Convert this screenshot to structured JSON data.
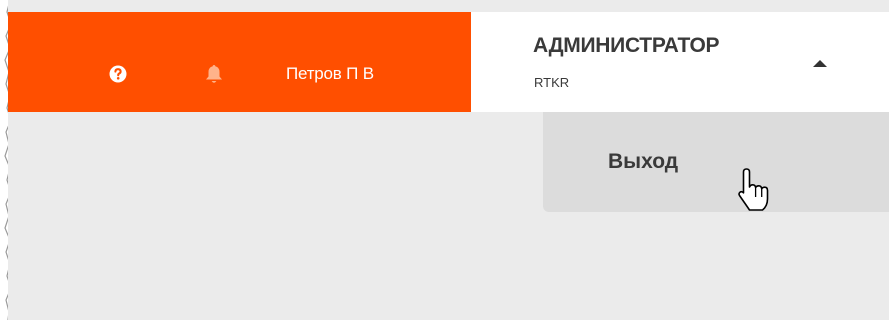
{
  "header": {
    "user_name": "Петров П В",
    "role_title": "АДМИНИСТРАТОР",
    "org_code": "RTKR",
    "help_icon": "question-circle-icon",
    "notifications_icon": "bell-icon",
    "toggle_icon": "caret-up-icon"
  },
  "user_menu": {
    "items": [
      {
        "label": "Выход"
      }
    ]
  },
  "colors": {
    "accent": "#ff4f00",
    "panel": "#ffffff",
    "background": "#ebebeb",
    "dropdown": "#dcdcdc",
    "text": "#3a3a3a"
  }
}
